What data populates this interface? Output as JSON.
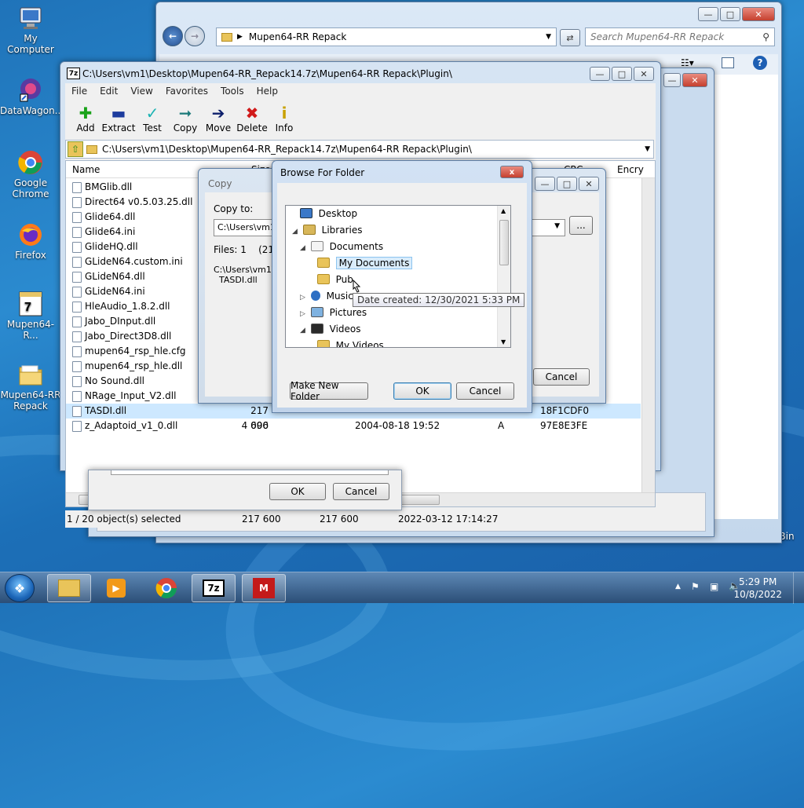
{
  "desktop": {
    "icons": [
      {
        "label": "My Computer"
      },
      {
        "label": "DataWagon..."
      },
      {
        "label": "Google Chrome"
      },
      {
        "label": "Firefox"
      },
      {
        "label": "Mupen64-R..."
      },
      {
        "label": "Mupen64-RR Repack"
      },
      {
        "label": "Recycle Bin"
      }
    ]
  },
  "explorer": {
    "address": "Mupen64-RR Repack",
    "search_placeholder": "Search Mupen64-RR Repack"
  },
  "sevenzip": {
    "icon_text": "7z",
    "title": "C:\\Users\\vm1\\Desktop\\Mupen64-RR_Repack14.7z\\Mupen64-RR Repack\\Plugin\\",
    "menu": [
      "File",
      "Edit",
      "View",
      "Favorites",
      "Tools",
      "Help"
    ],
    "toolbar": [
      {
        "label": "Add",
        "icon": "plus-icon",
        "color": "#1aa31a"
      },
      {
        "label": "Extract",
        "icon": "minus-icon",
        "color": "#1d3c9e"
      },
      {
        "label": "Test",
        "icon": "check-icon",
        "color": "#1bb3b3"
      },
      {
        "label": "Copy",
        "icon": "double-arrow-icon",
        "color": "#1b7a7a"
      },
      {
        "label": "Move",
        "icon": "arrow-icon",
        "color": "#0d1f6b"
      },
      {
        "label": "Delete",
        "icon": "x-icon",
        "color": "#d11a1a"
      },
      {
        "label": "Info",
        "icon": "info-icon",
        "color": "#c8a100"
      }
    ],
    "path": "C:\\Users\\vm1\\Desktop\\Mupen64-RR_Repack14.7z\\Mupen64-RR Repack\\Plugin\\",
    "columns": {
      "name": "Name",
      "size": "Size",
      "crc": "CRC",
      "encrypted": "Encry"
    },
    "files": [
      {
        "name": "BMGlib.dll"
      },
      {
        "name": "Direct64 v0.5.03.25.dll"
      },
      {
        "name": "Glide64.dll"
      },
      {
        "name": "Glide64.ini"
      },
      {
        "name": "GlideHQ.dll"
      },
      {
        "name": "GLideN64.custom.ini"
      },
      {
        "name": "GLideN64.dll"
      },
      {
        "name": "GLideN64.ini"
      },
      {
        "name": "HleAudio_1.8.2.dll"
      },
      {
        "name": "Jabo_DInput.dll"
      },
      {
        "name": "Jabo_Direct3D8.dll"
      },
      {
        "name": "mupen64_rsp_hle.cfg"
      },
      {
        "name": "mupen64_rsp_hle.dll"
      },
      {
        "name": "No Sound.dll"
      },
      {
        "name": "NRage_Input_V2.dll"
      },
      {
        "name": "TASDI.dll",
        "size": "217 600",
        "crc": "18F1CDF0"
      },
      {
        "name": "z_Adaptoid_v1_0.dll",
        "size": "4 096",
        "modified": "2004-08-18 19:52",
        "attr": "A",
        "crc": "97E8E3FE"
      }
    ],
    "status": {
      "selection": "1 / 20 object(s) selected",
      "size": "217 600",
      "packed": "217 600",
      "modified": "2022-03-12 17:14:27"
    }
  },
  "copy_dialog": {
    "title": "Copy",
    "copy_to_label": "Copy to:",
    "copy_to_value": "C:\\Users\\vm1\\",
    "files_info": "Files: 1    (217 (",
    "path_line": "C:\\Users\\vm1\\",
    "file_name": "TASDI.dll",
    "browse_label": "...",
    "cancel_label": "Cancel",
    "ok_label": "OK",
    "cancel2_label": "Cancel"
  },
  "browse": {
    "title": "Browse For Folder",
    "close_label": "x",
    "tree": [
      {
        "label": "Desktop"
      },
      {
        "label": "Libraries"
      },
      {
        "label": "Documents"
      },
      {
        "label": "My Documents"
      },
      {
        "label": "Pub"
      },
      {
        "label": "Music"
      },
      {
        "label": "Pictures"
      },
      {
        "label": "Videos"
      },
      {
        "label": "My Videos"
      }
    ],
    "tooltip": "Date created: 12/30/2021 5:33 PM",
    "new_folder_label": "Make New Folder",
    "ok_label": "OK",
    "cancel_label": "Cancel"
  },
  "taskbar": {
    "time": "5:29 PM",
    "date": "10/8/2022"
  }
}
